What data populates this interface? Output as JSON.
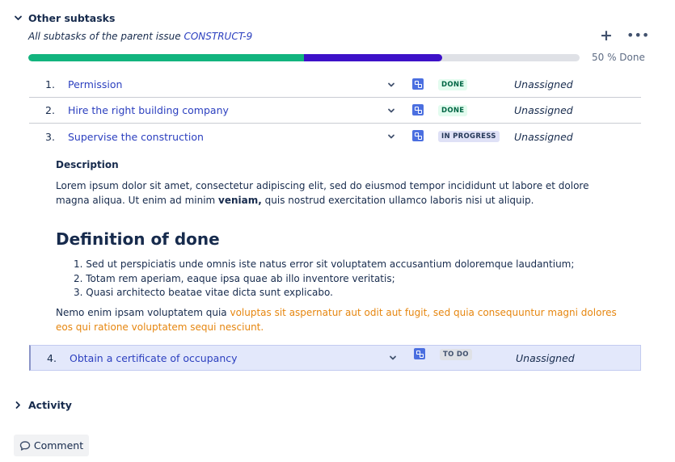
{
  "subtasks_section": {
    "title": "Other subtasks",
    "parent_text": "All subtasks of the parent issue",
    "parent_key": "CONSTRUCT-9",
    "add_icon": "plus-icon",
    "more_icon": "more-icon",
    "progress": {
      "done_fraction": 0.5,
      "in_progress_fraction": 0.25,
      "label": "50 % Done"
    },
    "colors": {
      "done": "#12b47e",
      "in_progress": "#3d11c8",
      "track": "#dfe1e6"
    },
    "items": [
      {
        "number": "1.",
        "title": "Permission",
        "status": "DONE",
        "assignee": "Unassigned"
      },
      {
        "number": "2.",
        "title": "Hire the right building company",
        "status": "DONE",
        "assignee": "Unassigned"
      },
      {
        "number": "3.",
        "title": "Supervise the construction",
        "status": "IN PROGRESS",
        "assignee": "Unassigned"
      },
      {
        "number": "4.",
        "title": "Obtain a certificate of occupancy",
        "status": "TO DO",
        "assignee": "Unassigned"
      }
    ]
  },
  "expanded_detail": {
    "description_heading": "Description",
    "description_text_1": "Lorem ipsum dolor sit amet, consectetur adipiscing elit, sed do eiusmod tempor incididunt ut labore et dolore magna aliqua. Ut enim ad minim ",
    "description_bold": "veniam,",
    "description_text_2": " quis nostrud exercitation ullamco laboris nisi ut aliquip.",
    "dod_heading": "Definition of done",
    "dod_items": [
      "1. Sed ut perspiciatis unde omnis iste natus error sit voluptatem accusantium doloremque laudantium;",
      "2. Totam rem aperiam, eaque ipsa quae ab illo inventore veritatis;",
      "3. Quasi architecto beatae vitae dicta sunt explicabo."
    ],
    "closing_plain": "Nemo enim ipsam voluptatem quia ",
    "closing_orange": "voluptas sit aspernatur aut odit aut fugit, sed quia consequuntur magni dolores eos qui ratione voluptatem sequi nesciunt."
  },
  "activity_section": {
    "title": "Activity"
  },
  "comment_button": {
    "label": "Comment",
    "icon": "comment-icon"
  }
}
